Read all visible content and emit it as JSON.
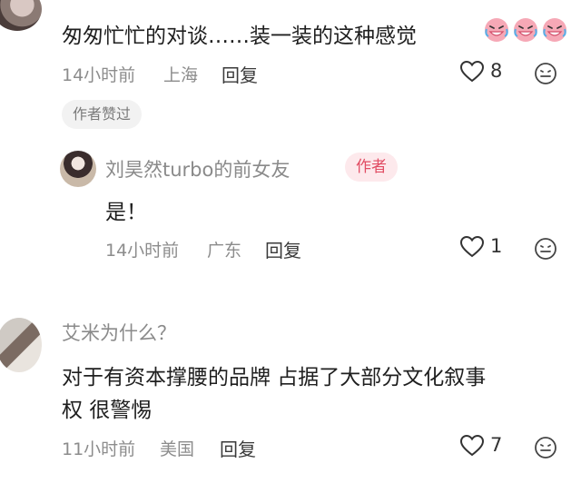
{
  "comments": [
    {
      "text": "匆匆忙忙的对谈……装一装的这种感觉",
      "time": "14小时前",
      "location": "上海",
      "reply_label": "回复",
      "likes": "8",
      "badge": "作者赞过",
      "emoji_icon": "crying-laughing-emoji-icon"
    },
    {
      "username": "刘昊然turbo的前女友",
      "author_badge": "作者",
      "text": "是！",
      "time": "14小时前",
      "location": "广东",
      "reply_label": "回复",
      "likes": "1"
    },
    {
      "username": "艾米为什么？",
      "text_line1": "对于有资本撑腰的品牌 占据了大部分文化叙事",
      "text_line2": "权 很警惕",
      "time": "11小时前",
      "location": "美国",
      "reply_label": "回复",
      "likes": "7"
    }
  ],
  "colors": {
    "author_badge": "#e14c63",
    "meta": "#8c8c8c"
  }
}
